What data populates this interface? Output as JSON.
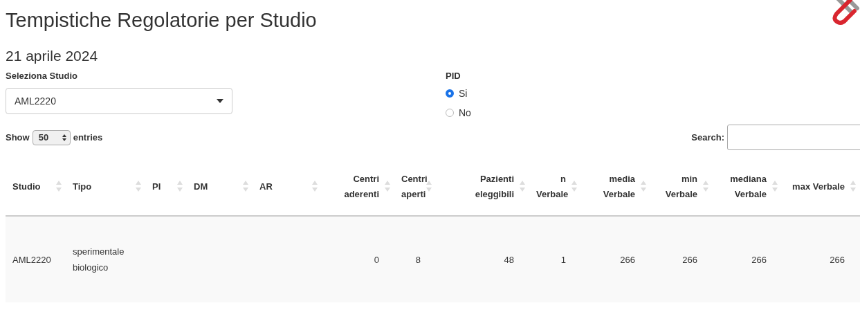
{
  "title": "Tempistiche Regolatorie per Studio",
  "date": "21 aprile 2024",
  "study_select": {
    "label": "Seleziona Studio",
    "value": "AML2220"
  },
  "pid": {
    "label": "PID",
    "options": [
      {
        "label": "Si",
        "selected": true
      },
      {
        "label": "No",
        "selected": false
      }
    ]
  },
  "length_control": {
    "before": "Show",
    "value": "50",
    "after": "entries"
  },
  "search": {
    "label": "Search:"
  },
  "table": {
    "columns": [
      {
        "label": "Studio",
        "kind": "text"
      },
      {
        "label": "Tipo",
        "kind": "text"
      },
      {
        "label": "PI",
        "kind": "text"
      },
      {
        "label": "DM",
        "kind": "text"
      },
      {
        "label": "AR",
        "kind": "text"
      },
      {
        "label": "Centri aderenti",
        "kind": "number"
      },
      {
        "label": "Centri aperti",
        "kind": "number"
      },
      {
        "label": "Pazienti eleggibili",
        "kind": "number"
      },
      {
        "label": "n Verbale",
        "kind": "number"
      },
      {
        "label": "media Verbale",
        "kind": "number"
      },
      {
        "label": "min Verbale",
        "kind": "number"
      },
      {
        "label": "mediana Verbale",
        "kind": "number"
      },
      {
        "label": "max Verbale",
        "kind": "number"
      }
    ],
    "rows": [
      {
        "cells": [
          "AML2220",
          "sperimentale biologico",
          null,
          null,
          null,
          "0",
          "8",
          "48",
          "1",
          "266",
          "266",
          "266",
          "266"
        ]
      }
    ]
  }
}
